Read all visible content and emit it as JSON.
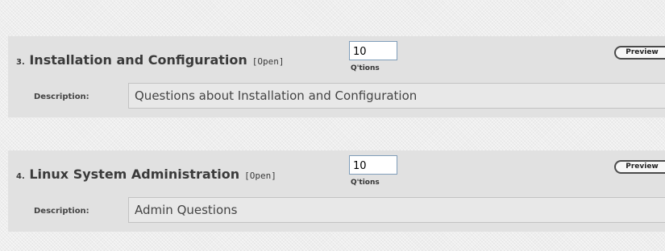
{
  "sections": [
    {
      "number": "3.",
      "title": "Installation and Configuration",
      "status": "[Open]",
      "question_count": "10",
      "questions_label": "Q'tions",
      "preview_label": "Preview",
      "description_label": "Description:",
      "description": "Questions about Installation and Configuration"
    },
    {
      "number": "4.",
      "title": "Linux System Administration",
      "status": "[Open]",
      "question_count": "10",
      "questions_label": "Q'tions",
      "preview_label": "Preview",
      "description_label": "Description:",
      "description": "Admin Questions"
    }
  ]
}
